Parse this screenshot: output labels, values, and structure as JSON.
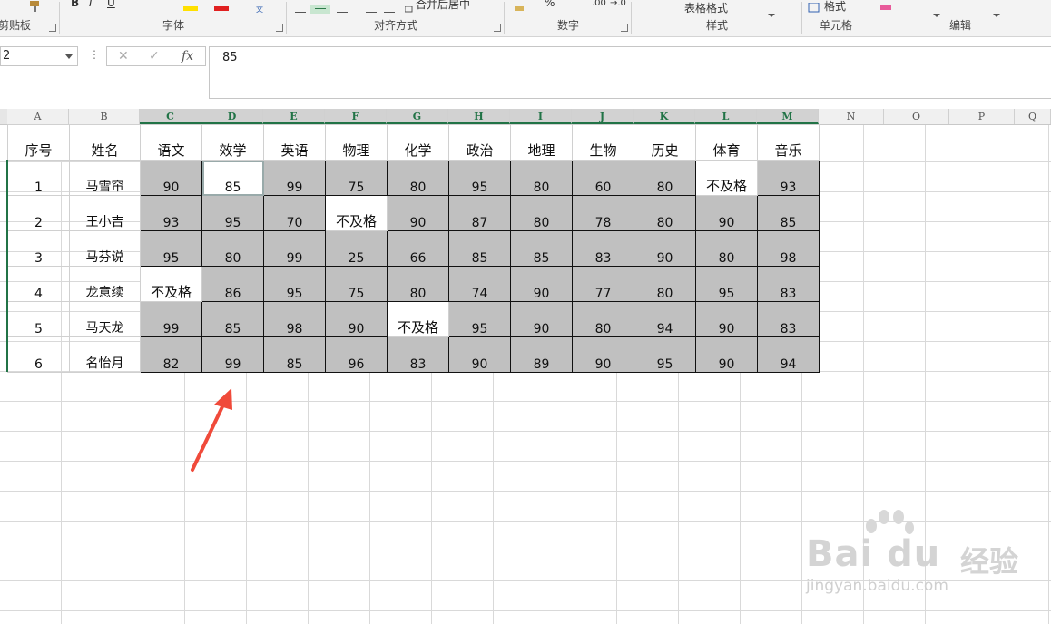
{
  "ribbon": {
    "groups": [
      {
        "label": "剪贴板"
      },
      {
        "label": "字体"
      },
      {
        "label": "对齐方式"
      },
      {
        "label": "数字"
      },
      {
        "label": "样式"
      },
      {
        "label": "单元格"
      },
      {
        "label": "编辑"
      }
    ],
    "font_buttons": {
      "bold": "B",
      "italic": "I",
      "underline": "U"
    },
    "wrap_label": "合并后居中",
    "percent_label": "%",
    "decimal_inc_label": ".00",
    "decimal_dec_label": "→.0",
    "table_style_label": "表格格式",
    "cell_format_label": "格式"
  },
  "formula_bar": {
    "name_box_value": "2",
    "cancel_glyph": "✕",
    "enter_glyph": "✓",
    "fx_label": "fx",
    "value": "85"
  },
  "columns": [
    {
      "letter": "A",
      "selected": false
    },
    {
      "letter": "B",
      "selected": false
    },
    {
      "letter": "C",
      "selected": true
    },
    {
      "letter": "D",
      "selected": true
    },
    {
      "letter": "E",
      "selected": true
    },
    {
      "letter": "F",
      "selected": true
    },
    {
      "letter": "G",
      "selected": true
    },
    {
      "letter": "H",
      "selected": true
    },
    {
      "letter": "I",
      "selected": true
    },
    {
      "letter": "J",
      "selected": true
    },
    {
      "letter": "K",
      "selected": true
    },
    {
      "letter": "L",
      "selected": true
    },
    {
      "letter": "M",
      "selected": true
    },
    {
      "letter": "N",
      "selected": false
    },
    {
      "letter": "O",
      "selected": false
    },
    {
      "letter": "P",
      "selected": false
    },
    {
      "letter": "Q",
      "selected": false
    }
  ],
  "table": {
    "headers": [
      "序号",
      "姓名",
      "语文",
      "效学",
      "英语",
      "物理",
      "化学",
      "政治",
      "地理",
      "生物",
      "历史",
      "体育",
      "音乐"
    ],
    "rows": [
      [
        "1",
        "马雪帘",
        "90",
        "85",
        "99",
        "75",
        "80",
        "95",
        "80",
        "60",
        "80",
        "不及格",
        "93"
      ],
      [
        "2",
        "王小吉",
        "93",
        "95",
        "70",
        "不及格",
        "90",
        "87",
        "80",
        "78",
        "80",
        "90",
        "85"
      ],
      [
        "3",
        "马芬说",
        "95",
        "80",
        "99",
        "25",
        "66",
        "85",
        "85",
        "83",
        "90",
        "80",
        "98"
      ],
      [
        "4",
        "龙意续",
        "不及格",
        "86",
        "95",
        "75",
        "80",
        "74",
        "90",
        "77",
        "80",
        "95",
        "83"
      ],
      [
        "5",
        "马天龙",
        "99",
        "85",
        "98",
        "90",
        "不及格",
        "95",
        "90",
        "80",
        "94",
        "90",
        "83"
      ],
      [
        "6",
        "名怡月",
        "82",
        "99",
        "85",
        "96",
        "83",
        "90",
        "89",
        "90",
        "95",
        "90",
        "94"
      ]
    ],
    "fail_text": "不及格",
    "active_cell": {
      "row": 0,
      "col": 3
    }
  },
  "watermark": {
    "brand": "Bai du",
    "cn": "经验",
    "url": "jingyan.baidu.com"
  },
  "colors": {
    "accent": "#217346",
    "cell_fill": "#c0c0c0",
    "arrow": "#f04a3a"
  }
}
